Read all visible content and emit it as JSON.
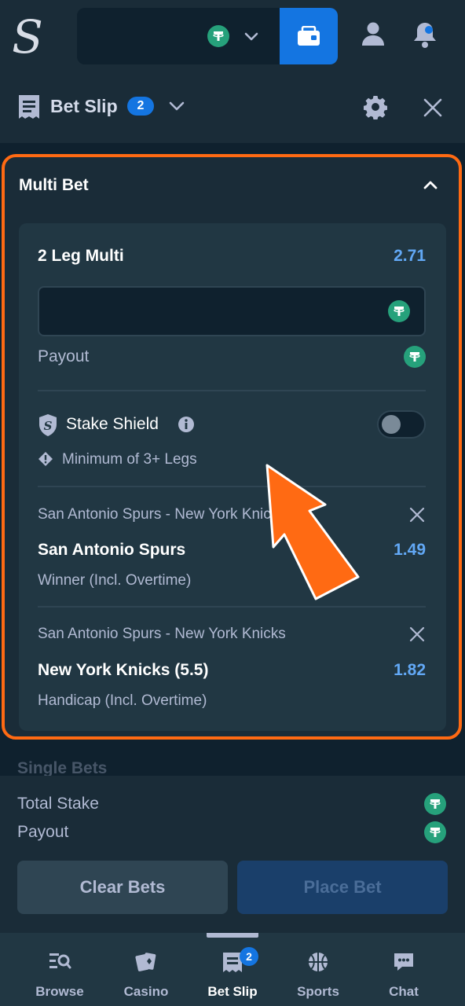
{
  "header": {
    "logo_text": "S",
    "currency_icon": "tether-coin-icon"
  },
  "betslip": {
    "title": "Bet Slip",
    "count": "2"
  },
  "multi": {
    "section_title": "Multi Bet",
    "leg_title": "2 Leg Multi",
    "odds": "2.71",
    "stake_value": "",
    "payout_label": "Payout",
    "shield_label": "Stake Shield",
    "min_legs_label": "Minimum of 3+ Legs",
    "shield_enabled": false
  },
  "legs": [
    {
      "event": "San Antonio Spurs - New York Knicks",
      "selection": "San Antonio Spurs",
      "odds": "1.49",
      "market": "Winner (Incl. Overtime)"
    },
    {
      "event": "San Antonio Spurs - New York Knicks",
      "selection": "New York Knicks (5.5)",
      "odds": "1.82",
      "market": "Handicap (Incl. Overtime)"
    }
  ],
  "peek_section": "Single Bets",
  "footer": {
    "total_stake_label": "Total Stake",
    "payout_label": "Payout",
    "clear_label": "Clear Bets",
    "place_label": "Place Bet"
  },
  "nav": [
    {
      "label": "Browse",
      "icon": "browse-icon"
    },
    {
      "label": "Casino",
      "icon": "casino-cards-icon"
    },
    {
      "label": "Bet Slip",
      "icon": "betslip-icon",
      "badge": "2",
      "active": true
    },
    {
      "label": "Sports",
      "icon": "basketball-icon"
    },
    {
      "label": "Chat",
      "icon": "chat-icon"
    }
  ],
  "colors": {
    "accent": "#1475e1",
    "highlight": "#ff6a13",
    "odds": "#62a8f5",
    "tether": "#26a17b"
  }
}
